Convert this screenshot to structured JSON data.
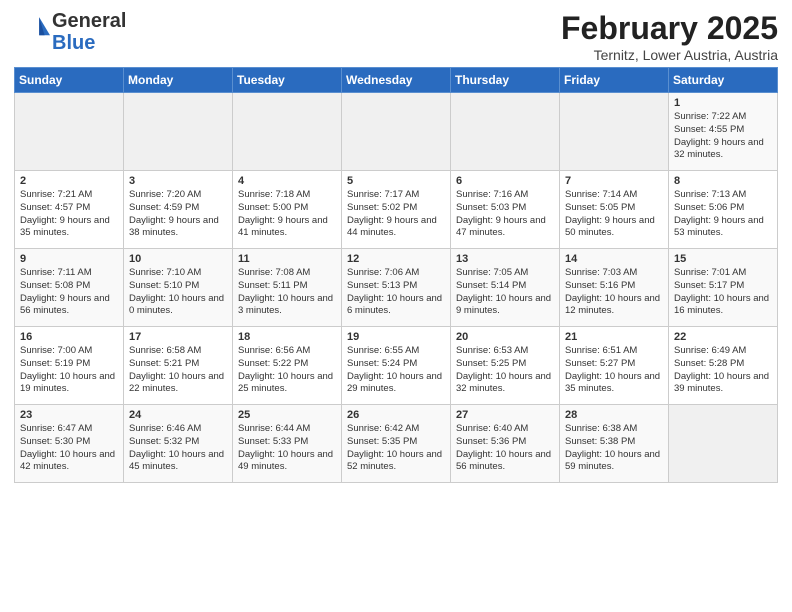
{
  "header": {
    "logo_general": "General",
    "logo_blue": "Blue",
    "month": "February 2025",
    "location": "Ternitz, Lower Austria, Austria"
  },
  "weekdays": [
    "Sunday",
    "Monday",
    "Tuesday",
    "Wednesday",
    "Thursday",
    "Friday",
    "Saturday"
  ],
  "weeks": [
    [
      {
        "day": "",
        "info": ""
      },
      {
        "day": "",
        "info": ""
      },
      {
        "day": "",
        "info": ""
      },
      {
        "day": "",
        "info": ""
      },
      {
        "day": "",
        "info": ""
      },
      {
        "day": "",
        "info": ""
      },
      {
        "day": "1",
        "info": "Sunrise: 7:22 AM\nSunset: 4:55 PM\nDaylight: 9 hours and 32 minutes."
      }
    ],
    [
      {
        "day": "2",
        "info": "Sunrise: 7:21 AM\nSunset: 4:57 PM\nDaylight: 9 hours and 35 minutes."
      },
      {
        "day": "3",
        "info": "Sunrise: 7:20 AM\nSunset: 4:59 PM\nDaylight: 9 hours and 38 minutes."
      },
      {
        "day": "4",
        "info": "Sunrise: 7:18 AM\nSunset: 5:00 PM\nDaylight: 9 hours and 41 minutes."
      },
      {
        "day": "5",
        "info": "Sunrise: 7:17 AM\nSunset: 5:02 PM\nDaylight: 9 hours and 44 minutes."
      },
      {
        "day": "6",
        "info": "Sunrise: 7:16 AM\nSunset: 5:03 PM\nDaylight: 9 hours and 47 minutes."
      },
      {
        "day": "7",
        "info": "Sunrise: 7:14 AM\nSunset: 5:05 PM\nDaylight: 9 hours and 50 minutes."
      },
      {
        "day": "8",
        "info": "Sunrise: 7:13 AM\nSunset: 5:06 PM\nDaylight: 9 hours and 53 minutes."
      }
    ],
    [
      {
        "day": "9",
        "info": "Sunrise: 7:11 AM\nSunset: 5:08 PM\nDaylight: 9 hours and 56 minutes."
      },
      {
        "day": "10",
        "info": "Sunrise: 7:10 AM\nSunset: 5:10 PM\nDaylight: 10 hours and 0 minutes."
      },
      {
        "day": "11",
        "info": "Sunrise: 7:08 AM\nSunset: 5:11 PM\nDaylight: 10 hours and 3 minutes."
      },
      {
        "day": "12",
        "info": "Sunrise: 7:06 AM\nSunset: 5:13 PM\nDaylight: 10 hours and 6 minutes."
      },
      {
        "day": "13",
        "info": "Sunrise: 7:05 AM\nSunset: 5:14 PM\nDaylight: 10 hours and 9 minutes."
      },
      {
        "day": "14",
        "info": "Sunrise: 7:03 AM\nSunset: 5:16 PM\nDaylight: 10 hours and 12 minutes."
      },
      {
        "day": "15",
        "info": "Sunrise: 7:01 AM\nSunset: 5:17 PM\nDaylight: 10 hours and 16 minutes."
      }
    ],
    [
      {
        "day": "16",
        "info": "Sunrise: 7:00 AM\nSunset: 5:19 PM\nDaylight: 10 hours and 19 minutes."
      },
      {
        "day": "17",
        "info": "Sunrise: 6:58 AM\nSunset: 5:21 PM\nDaylight: 10 hours and 22 minutes."
      },
      {
        "day": "18",
        "info": "Sunrise: 6:56 AM\nSunset: 5:22 PM\nDaylight: 10 hours and 25 minutes."
      },
      {
        "day": "19",
        "info": "Sunrise: 6:55 AM\nSunset: 5:24 PM\nDaylight: 10 hours and 29 minutes."
      },
      {
        "day": "20",
        "info": "Sunrise: 6:53 AM\nSunset: 5:25 PM\nDaylight: 10 hours and 32 minutes."
      },
      {
        "day": "21",
        "info": "Sunrise: 6:51 AM\nSunset: 5:27 PM\nDaylight: 10 hours and 35 minutes."
      },
      {
        "day": "22",
        "info": "Sunrise: 6:49 AM\nSunset: 5:28 PM\nDaylight: 10 hours and 39 minutes."
      }
    ],
    [
      {
        "day": "23",
        "info": "Sunrise: 6:47 AM\nSunset: 5:30 PM\nDaylight: 10 hours and 42 minutes."
      },
      {
        "day": "24",
        "info": "Sunrise: 6:46 AM\nSunset: 5:32 PM\nDaylight: 10 hours and 45 minutes."
      },
      {
        "day": "25",
        "info": "Sunrise: 6:44 AM\nSunset: 5:33 PM\nDaylight: 10 hours and 49 minutes."
      },
      {
        "day": "26",
        "info": "Sunrise: 6:42 AM\nSunset: 5:35 PM\nDaylight: 10 hours and 52 minutes."
      },
      {
        "day": "27",
        "info": "Sunrise: 6:40 AM\nSunset: 5:36 PM\nDaylight: 10 hours and 56 minutes."
      },
      {
        "day": "28",
        "info": "Sunrise: 6:38 AM\nSunset: 5:38 PM\nDaylight: 10 hours and 59 minutes."
      },
      {
        "day": "",
        "info": ""
      }
    ]
  ]
}
